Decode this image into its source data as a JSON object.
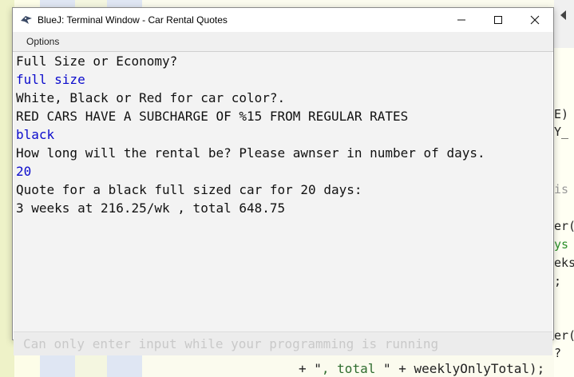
{
  "window": {
    "title": "BlueJ: Terminal Window - Car Rental Quotes",
    "menu_options": "Options",
    "minimize_icon": "minimize-icon",
    "maximize_icon": "maximize-icon",
    "close_icon": "close-icon"
  },
  "terminal": {
    "lines": [
      {
        "text": "Full Size or Economy?",
        "kind": "output"
      },
      {
        "text": "full size",
        "kind": "input"
      },
      {
        "text": "White, Black or Red for car color?.",
        "kind": "output"
      },
      {
        "text": "RED CARS HAVE A SUBCHARGE OF %15 FROM REGULAR RATES",
        "kind": "output"
      },
      {
        "text": "black",
        "kind": "input"
      },
      {
        "text": "How long will the rental be? Please awnser in number of days.",
        "kind": "output"
      },
      {
        "text": "20",
        "kind": "input"
      },
      {
        "text": "Quote for a black full sized car for 20 days:",
        "kind": "output"
      },
      {
        "text": "3 weeks at 216.25/wk , total 648.75",
        "kind": "output"
      }
    ],
    "input_placeholder": "Can only enter input while your programming is running"
  },
  "background_editor": {
    "right_fragments": [
      "E)",
      "Y_",
      "is",
      "er(",
      "ys",
      "eks",
      ";",
      "er(",
      "?"
    ],
    "bottom_code_prefix": "+ \"",
    "bottom_code_string": ", total ",
    "bottom_code_suffix": "\" + weeklyOnlyTotal);"
  },
  "colors": {
    "user_input": "#0b0bcc",
    "output_text": "#111111"
  }
}
